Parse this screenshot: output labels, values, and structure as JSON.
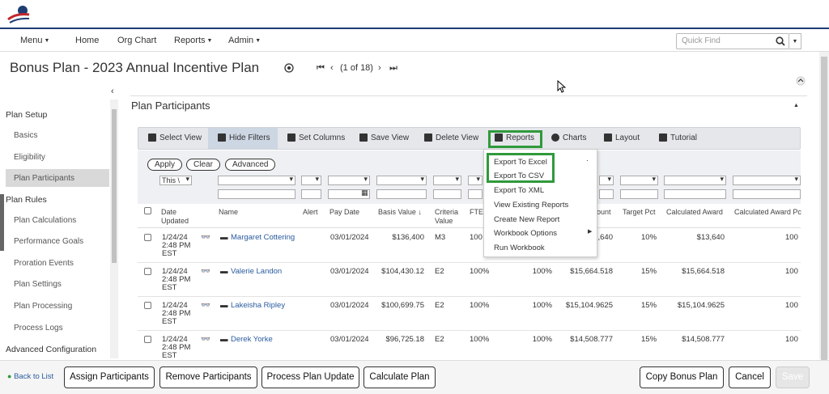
{
  "nav": {
    "menu": "Menu",
    "home": "Home",
    "org_chart": "Org Chart",
    "reports": "Reports",
    "admin": "Admin",
    "quick_find_placeholder": "Quick Find"
  },
  "header": {
    "title": "Bonus Plan - 2023 Annual Incentive Plan",
    "pager": "(1 of 18)"
  },
  "sidebar": {
    "plan_setup": "Plan Setup",
    "basics": "Basics",
    "eligibility": "Eligibility",
    "plan_participants": "Plan Participants",
    "plan_rules": "Plan Rules",
    "plan_calculations": "Plan Calculations",
    "performance_goals": "Performance Goals",
    "proration_events": "Proration Events",
    "plan_settings": "Plan Settings",
    "plan_processing": "Plan Processing",
    "process_logs": "Process Logs",
    "advanced_configuration": "Advanced Configuration"
  },
  "section": {
    "title": "Plan Participants"
  },
  "toolbar": {
    "select_view": "Select View",
    "hide_filters": "Hide Filters",
    "set_columns": "Set Columns",
    "save_view": "Save View",
    "delete_view": "Delete View",
    "reports": "Reports",
    "charts": "Charts",
    "layout": "Layout",
    "tutorial": "Tutorial"
  },
  "filters": {
    "apply": "Apply",
    "clear": "Clear",
    "advanced": "Advanced",
    "date_select": "This \\"
  },
  "reports_menu": {
    "export_excel": "Export To Excel",
    "export_csv": "Export To CSV",
    "export_xml": "Export To XML",
    "view_existing": "View Existing Reports",
    "create_new": "Create New Report",
    "workbook_options": "Workbook Options",
    "run_workbook": "Run Workbook"
  },
  "grid": {
    "headers": {
      "date_updated_1": "Date",
      "date_updated_2": "Updated",
      "name": "Name",
      "alert": "Alert",
      "pay_date": "Pay Date",
      "basis_value": "Basis Value ↓",
      "criteria_value_1": "Criteria",
      "criteria_value_2": "Value",
      "fte": "FTE",
      "amount": "ount",
      "target_pct": "Target Pct",
      "calculated_award": "Calculated Award",
      "calculated_award_pct": "Calculated Award Pc"
    },
    "rows": [
      {
        "d1": "1/24/24",
        "d2": "2:48 PM",
        "d3": "EST",
        "name": "Margaret Cottering",
        "pay_date": "03/01/2024",
        "basis": "$136,400",
        "criteria": "M3",
        "fte": "100",
        "pct2": "",
        "amount": ",640",
        "target": "10%",
        "award": "$13,640",
        "award_pct": "100"
      },
      {
        "d1": "1/24/24",
        "d2": "2:48 PM",
        "d3": "EST",
        "name": "Valerie Landon",
        "pay_date": "03/01/2024",
        "basis": "$104,430.12",
        "criteria": "E2",
        "fte": "100%",
        "pct2": "100%",
        "amount": "$15,664.518",
        "target": "15%",
        "award": "$15,664.518",
        "award_pct": "100"
      },
      {
        "d1": "1/24/24",
        "d2": "2:48 PM",
        "d3": "EST",
        "name": "Lakeisha Ripley",
        "pay_date": "03/01/2024",
        "basis": "$100,699.75",
        "criteria": "E2",
        "fte": "100%",
        "pct2": "100%",
        "amount": "$15,104.9625",
        "target": "15%",
        "award": "$15,104.9625",
        "award_pct": "100"
      },
      {
        "d1": "1/24/24",
        "d2": "2:48 PM",
        "d3": "EST",
        "name": "Derek Yorke",
        "pay_date": "03/01/2024",
        "basis": "$96,725.18",
        "criteria": "E2",
        "fte": "100%",
        "pct2": "100%",
        "amount": "$14,508.777",
        "target": "15%",
        "award": "$14,508.777",
        "award_pct": "100"
      }
    ]
  },
  "footer": {
    "back": "Back to List",
    "assign": "Assign Participants",
    "remove": "Remove Participants",
    "process": "Process Plan Update",
    "calculate": "Calculate Plan",
    "copy": "Copy Bonus Plan",
    "cancel": "Cancel",
    "save": "Save"
  },
  "colors": {
    "accent_green": "#2f9a3c",
    "brand_navy": "#1f3d73",
    "brand_red": "#c0272d",
    "link_blue": "#2a5b9f"
  }
}
